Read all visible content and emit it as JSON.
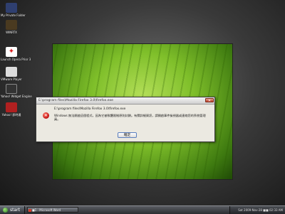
{
  "desktop": {
    "icons": [
      {
        "label": "My Private Folder"
      },
      {
        "label": "WINRTX"
      },
      {
        "label": "Launch Opera Prior 3"
      },
      {
        "label": "VMware Player"
      },
      {
        "label": "Yahoo! Widget Engine"
      },
      {
        "label": "Yahoo! 即時通"
      }
    ]
  },
  "dialog": {
    "title": "E:\\program files\\Mozilla Firefox 3.0\\firefox.exe",
    "close_label": "✕",
    "path": "E:\\program files\\Mozilla Firefox 3.0\\firefox.exe",
    "message": "Windows 無法開啟這個程式，因為它被軟體限制原則封鎖。有關詳細資訊，請開啟事件檢視器或連絡您的系統管理員。",
    "ok_label": "確定",
    "icon": "error-icon"
  },
  "taskbar": {
    "start_label": "start",
    "task_label": "■1 - Microsoft Word",
    "clock": "Sat 2009-Nov-28 ■■ 02:33 AM"
  }
}
